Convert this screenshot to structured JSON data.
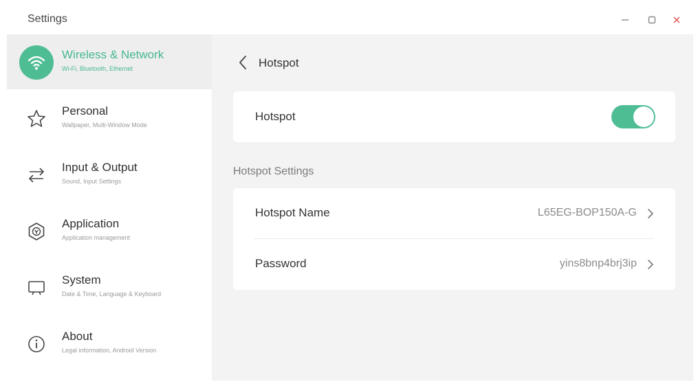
{
  "window": {
    "title": "Settings"
  },
  "window_controls": [
    "minimize-icon",
    "maximize-icon",
    "close-icon"
  ],
  "colors": {
    "accent": "#4fbd94",
    "close": "#e25555",
    "sidebar_active_bg": "#eeeeef",
    "content_bg": "#f3f3f4"
  },
  "sidebar": {
    "items": [
      {
        "title": "Wireless & Network",
        "subtitle": "Wi-Fi, Bluetooth, Ethernet",
        "icon": "wifi-icon",
        "active": true
      },
      {
        "title": "Personal",
        "subtitle": "Wallpaper, Multi-Window Mode",
        "icon": "star-icon",
        "active": false
      },
      {
        "title": "Input & Output",
        "subtitle": "Sound, Input Settings",
        "icon": "swap-arrows-icon",
        "active": false
      },
      {
        "title": "Application",
        "subtitle": "Application management",
        "icon": "application-icon",
        "active": false
      },
      {
        "title": "System",
        "subtitle": "Date & Time, Language & Keyboard",
        "icon": "monitor-icon",
        "active": false
      },
      {
        "title": "About",
        "subtitle": "Legal information, Android Version",
        "icon": "info-icon",
        "active": false
      }
    ]
  },
  "content": {
    "page_title": "Hotspot",
    "hotspot_toggle": {
      "label": "Hotspot",
      "enabled": true
    },
    "section_label": "Hotspot Settings",
    "settings": [
      {
        "label": "Hotspot Name",
        "value": "L65EG-BOP150A-G"
      },
      {
        "label": "Password",
        "value": "yins8bnp4brj3ip"
      }
    ]
  }
}
